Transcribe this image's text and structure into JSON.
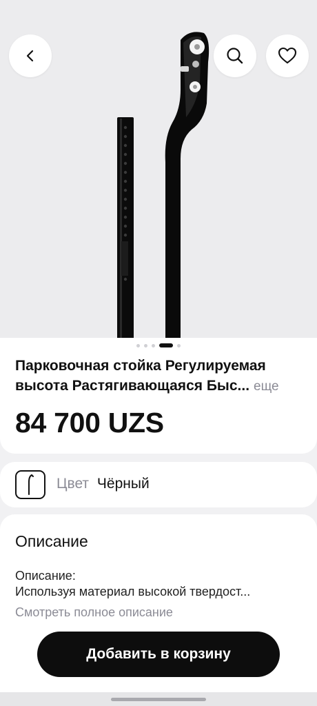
{
  "product": {
    "title_line1": "Парковочная стойка Регулируемая",
    "title_line2": "высота Растягивающаяся Быс...",
    "more_label": "еще",
    "price": "84 700 UZS"
  },
  "gallery": {
    "slide_count": 5,
    "active_slide": 4
  },
  "icons": {
    "back": "chevron-left-icon",
    "search": "search-icon",
    "favorite": "heart-icon"
  },
  "color_option": {
    "label": "Цвет",
    "value": "Чёрный"
  },
  "description": {
    "heading": "Описание",
    "subheading": "Описание:",
    "body": "Используя материал высокой твердост...",
    "link": "Смотреть полное описание"
  },
  "cart": {
    "button_label": "Добавить в корзину"
  },
  "colors": {
    "accent_button": "#0d0d0d",
    "muted_text": "#8b8b95",
    "background": "#f1f1f3"
  }
}
